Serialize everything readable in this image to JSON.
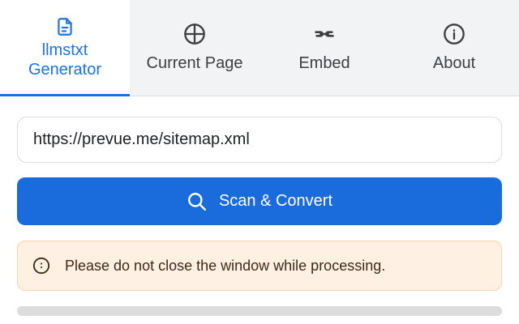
{
  "tabs": [
    {
      "label": "llmstxt\nGenerator",
      "icon": "document-icon",
      "active": true
    },
    {
      "label": "Current Page",
      "icon": "globe-icon",
      "active": false
    },
    {
      "label": "Embed",
      "icon": "link-icon",
      "active": false
    },
    {
      "label": "About",
      "icon": "info-icon",
      "active": false
    }
  ],
  "url_input": {
    "value": "https://prevue.me/sitemap.xml",
    "placeholder": ""
  },
  "scan_button": {
    "label": "Scan & Convert",
    "icon": "search-icon"
  },
  "notice": {
    "text": "Please do not close the window while processing.",
    "icon": "clock-icon"
  },
  "progress": {
    "value": 0
  },
  "colors": {
    "accent": "#1a73e8",
    "button": "#1a6bdc",
    "tab_bar": "#f1f3f4",
    "notice_bg": "#fef0e3",
    "notice_border": "#f6d5a8"
  }
}
